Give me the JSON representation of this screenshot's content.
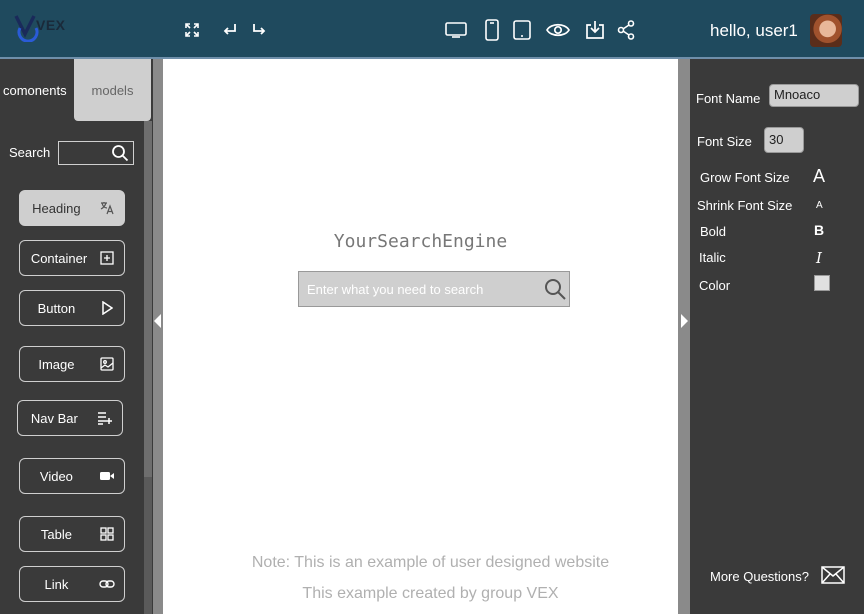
{
  "header": {
    "logo_text": "VEX",
    "greeting": "hello, user1",
    "toolbar_icons": [
      "fullscreen-icon",
      "undo-icon",
      "redo-icon",
      "desktop-icon",
      "mobile-icon",
      "tablet-icon",
      "preview-icon",
      "download-icon",
      "share-icon"
    ]
  },
  "left_panel": {
    "tabs": {
      "components": "comonents",
      "models": "models"
    },
    "search_label": "Search",
    "components": [
      {
        "label": "Heading",
        "icon": "translate-icon"
      },
      {
        "label": "Container",
        "icon": "grid-plus-icon"
      },
      {
        "label": "Button",
        "icon": "play-icon"
      },
      {
        "label": "Image",
        "icon": "image-icon"
      },
      {
        "label": "Nav Bar",
        "icon": "list-add-icon"
      },
      {
        "label": "Video",
        "icon": "video-icon"
      },
      {
        "label": "Table",
        "icon": "table-icon"
      },
      {
        "label": "Link",
        "icon": "link-icon"
      }
    ]
  },
  "canvas": {
    "engine_title": "YourSearchEngine",
    "search_placeholder": "Enter what you need to search",
    "note1": "Note: This is an example of user designed website",
    "note2": "This example created by group VEX"
  },
  "right_panel": {
    "font_name_label": "Font Name",
    "font_name_value": "Mnoaco",
    "font_size_label": "Font Size",
    "font_size_value": "30",
    "grow_label": "Grow Font Size",
    "grow_icon_text": "A",
    "shrink_label": "Shrink Font Size",
    "shrink_icon_text": "A",
    "bold_label": "Bold",
    "bold_icon_text": "B",
    "italic_label": "Italic",
    "italic_icon_text": "I",
    "color_label": "Color",
    "more_questions": "More Questions?"
  },
  "colors": {
    "header_bg": "#1f4a5e",
    "panel_bg": "#3a3a3a",
    "canvas_bg": "#ffffff",
    "active_button_bg": "#cfcfcf"
  }
}
